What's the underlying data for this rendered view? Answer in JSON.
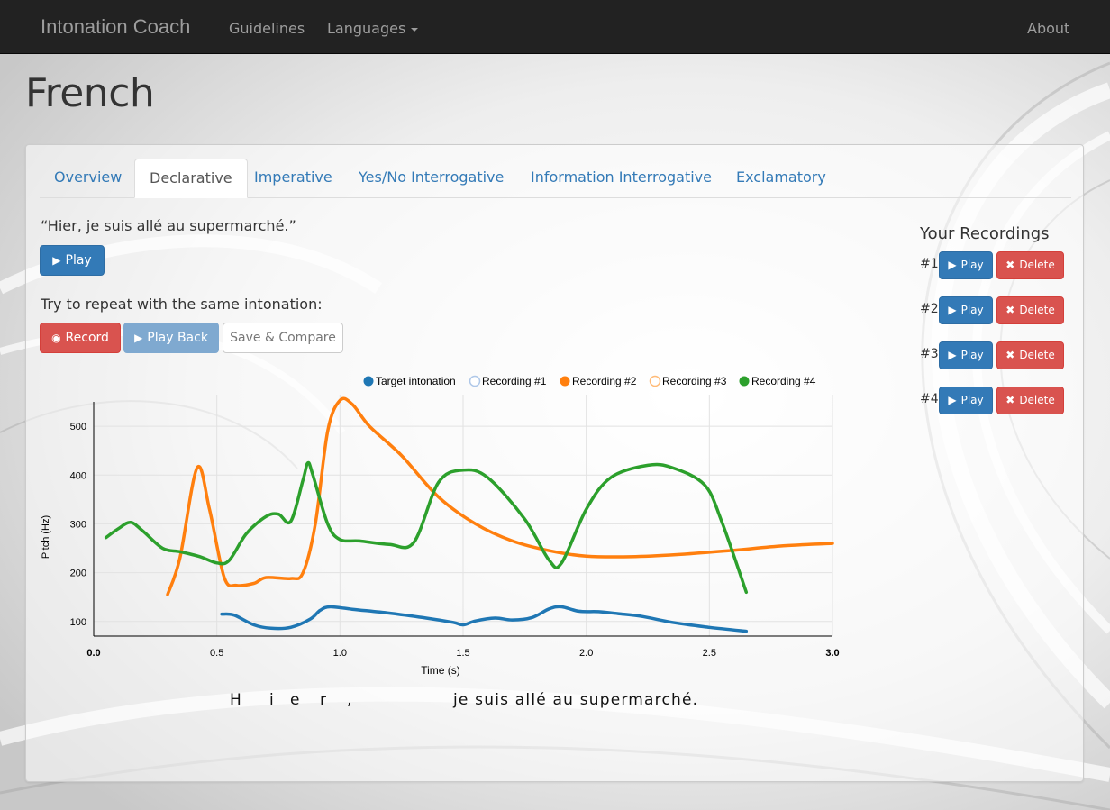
{
  "navbar": {
    "brand": "Intonation Coach",
    "links": {
      "guidelines": "Guidelines",
      "languages": "Languages",
      "about": "About"
    }
  },
  "page": {
    "title": "French"
  },
  "tabs": [
    {
      "label": "Overview",
      "active": false
    },
    {
      "label": "Declarative",
      "active": true
    },
    {
      "label": "Imperative",
      "active": false
    },
    {
      "label": "Yes/No Interrogative",
      "active": false
    },
    {
      "label": "Information Interrogative",
      "active": false
    },
    {
      "label": "Exclamatory",
      "active": false
    }
  ],
  "exercise": {
    "phrase": "“Hier, je suis allé au supermarché.”",
    "play_label": "Play",
    "instruction": "Try to repeat with the same intonation:",
    "record_label": "Record",
    "playback_label": "Play Back",
    "save_label": "Save & Compare"
  },
  "recordings_panel": {
    "title": "Your Recordings",
    "items": [
      {
        "num": "#1",
        "play": "Play",
        "delete": "Delete"
      },
      {
        "num": "#2",
        "play": "Play",
        "delete": "Delete"
      },
      {
        "num": "#3",
        "play": "Play",
        "delete": "Delete"
      },
      {
        "num": "#4",
        "play": "Play",
        "delete": "Delete"
      }
    ]
  },
  "syllables": {
    "a": "H",
    "b": "i",
    "c": "e",
    "d": "r",
    "e": ",",
    "f": "je suis allé au supermarché."
  },
  "colors": {
    "target": "#1f77b4",
    "rec1": "#aec7e8",
    "rec2": "#ff7f0e",
    "rec3": "#ffbb78",
    "rec4": "#2ca02c",
    "primary": "#337ab7",
    "danger": "#d9534f",
    "navbar": "#222222"
  },
  "icons": {
    "play": "play-icon",
    "record": "record-icon",
    "delete": "times-icon"
  },
  "chart_data": {
    "type": "line",
    "xlabel": "Time (s)",
    "ylabel": "Pitch (Hz)",
    "xlim": [
      0.0,
      3.0
    ],
    "ylim": [
      70,
      550
    ],
    "xticks": [
      "0.0",
      "0.5",
      "1.0",
      "1.5",
      "2.0",
      "2.5",
      "3.0"
    ],
    "yticks": [
      "100",
      "200",
      "300",
      "400",
      "500"
    ],
    "grid": true,
    "legend_position": "top",
    "series": [
      {
        "name": "Target intonation",
        "color": "#1f77b4",
        "hollow": false,
        "points": [
          [
            0.52,
            115
          ],
          [
            0.57,
            113
          ],
          [
            0.65,
            93
          ],
          [
            0.72,
            86
          ],
          [
            0.8,
            88
          ],
          [
            0.88,
            105
          ],
          [
            0.92,
            123
          ],
          [
            0.96,
            130
          ],
          [
            1.05,
            125
          ],
          [
            1.2,
            117
          ],
          [
            1.35,
            107
          ],
          [
            1.46,
            98
          ],
          [
            1.5,
            93
          ],
          [
            1.55,
            101
          ],
          [
            1.63,
            107
          ],
          [
            1.7,
            103
          ],
          [
            1.78,
            108
          ],
          [
            1.85,
            126
          ],
          [
            1.9,
            130
          ],
          [
            1.97,
            121
          ],
          [
            2.05,
            120
          ],
          [
            2.13,
            116
          ],
          [
            2.23,
            110
          ],
          [
            2.35,
            98
          ],
          [
            2.5,
            88
          ],
          [
            2.65,
            80
          ]
        ]
      },
      {
        "name": "Recording #1",
        "color": "#aec7e8",
        "hollow": true,
        "points": []
      },
      {
        "name": "Recording #2",
        "color": "#ff7f0e",
        "hollow": false,
        "points": [
          [
            0.3,
            155
          ],
          [
            0.35,
            230
          ],
          [
            0.42,
            415
          ],
          [
            0.47,
            330
          ],
          [
            0.53,
            190
          ],
          [
            0.58,
            174
          ],
          [
            0.65,
            178
          ],
          [
            0.7,
            190
          ],
          [
            0.8,
            188
          ],
          [
            0.85,
            200
          ],
          [
            0.9,
            300
          ],
          [
            0.95,
            490
          ],
          [
            1.0,
            553
          ],
          [
            1.05,
            545
          ],
          [
            1.12,
            500
          ],
          [
            1.25,
            440
          ],
          [
            1.4,
            355
          ],
          [
            1.55,
            300
          ],
          [
            1.7,
            265
          ],
          [
            1.85,
            245
          ],
          [
            2.0,
            234
          ],
          [
            2.2,
            233
          ],
          [
            2.4,
            238
          ],
          [
            2.6,
            246
          ],
          [
            2.8,
            255
          ],
          [
            3.0,
            260
          ]
        ]
      },
      {
        "name": "Recording #3",
        "color": "#ffbb78",
        "hollow": true,
        "points": []
      },
      {
        "name": "Recording #4",
        "color": "#2ca02c",
        "hollow": false,
        "points": [
          [
            0.05,
            272
          ],
          [
            0.1,
            290
          ],
          [
            0.15,
            303
          ],
          [
            0.2,
            285
          ],
          [
            0.28,
            250
          ],
          [
            0.35,
            243
          ],
          [
            0.43,
            233
          ],
          [
            0.5,
            220
          ],
          [
            0.55,
            225
          ],
          [
            0.62,
            280
          ],
          [
            0.7,
            315
          ],
          [
            0.75,
            320
          ],
          [
            0.8,
            305
          ],
          [
            0.85,
            390
          ],
          [
            0.87,
            425
          ],
          [
            0.89,
            400
          ],
          [
            0.95,
            300
          ],
          [
            1.0,
            268
          ],
          [
            1.08,
            265
          ],
          [
            1.2,
            258
          ],
          [
            1.3,
            262
          ],
          [
            1.4,
            385
          ],
          [
            1.5,
            410
          ],
          [
            1.6,
            395
          ],
          [
            1.75,
            310
          ],
          [
            1.85,
            225
          ],
          [
            1.9,
            220
          ],
          [
            2.0,
            330
          ],
          [
            2.1,
            395
          ],
          [
            2.25,
            420
          ],
          [
            2.35,
            415
          ],
          [
            2.48,
            380
          ],
          [
            2.55,
            305
          ],
          [
            2.65,
            160
          ]
        ]
      }
    ]
  }
}
